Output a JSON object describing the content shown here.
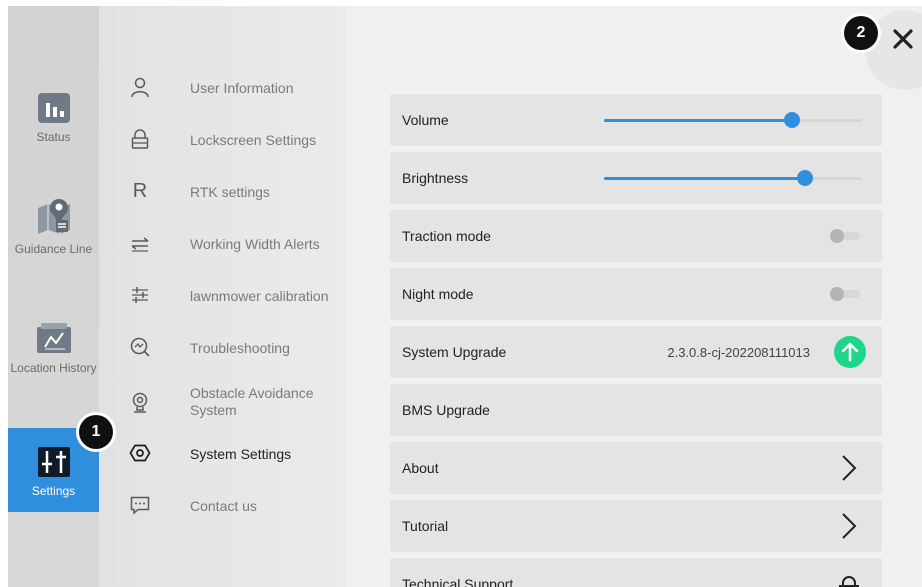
{
  "rail": {
    "items": [
      {
        "label": "Status",
        "icon": "bar-chart-icon"
      },
      {
        "label": "Guidance Line",
        "icon": "map-pin-icon"
      },
      {
        "label": "Location History",
        "icon": "history-chart-icon"
      },
      {
        "label": "Settings",
        "icon": "settings-sliders-icon",
        "active": true
      }
    ]
  },
  "menu": {
    "items": [
      {
        "label": "User Information",
        "icon": "user-icon"
      },
      {
        "label": "Lockscreen Settings",
        "icon": "lock-icon"
      },
      {
        "label": "RTK settings",
        "icon": "rtk-r-icon",
        "glyph": "R"
      },
      {
        "label": "Working Width Alerts",
        "icon": "width-arrows-icon"
      },
      {
        "label": "lawnmower calibration",
        "icon": "calibration-sliders-icon"
      },
      {
        "label": "Troubleshooting",
        "icon": "troubleshoot-search-icon"
      },
      {
        "label": "Obstacle Avoidance System",
        "icon": "obstacle-sensor-icon"
      },
      {
        "label": "System Settings",
        "icon": "hexagon-gear-icon",
        "active": true
      },
      {
        "label": "Contact us",
        "icon": "chat-bubble-icon"
      }
    ]
  },
  "settings": {
    "volume": {
      "label": "Volume",
      "level": 0.73
    },
    "brightness": {
      "label": "Brightness",
      "level": 0.78
    },
    "traction": {
      "label": "Traction mode",
      "on": false
    },
    "night": {
      "label": "Night mode",
      "on": false
    },
    "upgrade": {
      "label": "System Upgrade",
      "version": "2.3.0.8-cj-202208111013",
      "icon": "upgrade-arrow-icon"
    },
    "bms": {
      "label": "BMS Upgrade"
    },
    "about": {
      "label": "About"
    },
    "tutorial": {
      "label": "Tutorial"
    },
    "support": {
      "label": "Technical Support"
    }
  },
  "badges": {
    "one": "1",
    "two": "2"
  },
  "colors": {
    "accent": "#2f8fdc",
    "upgrade_green": "#1ed68a"
  }
}
